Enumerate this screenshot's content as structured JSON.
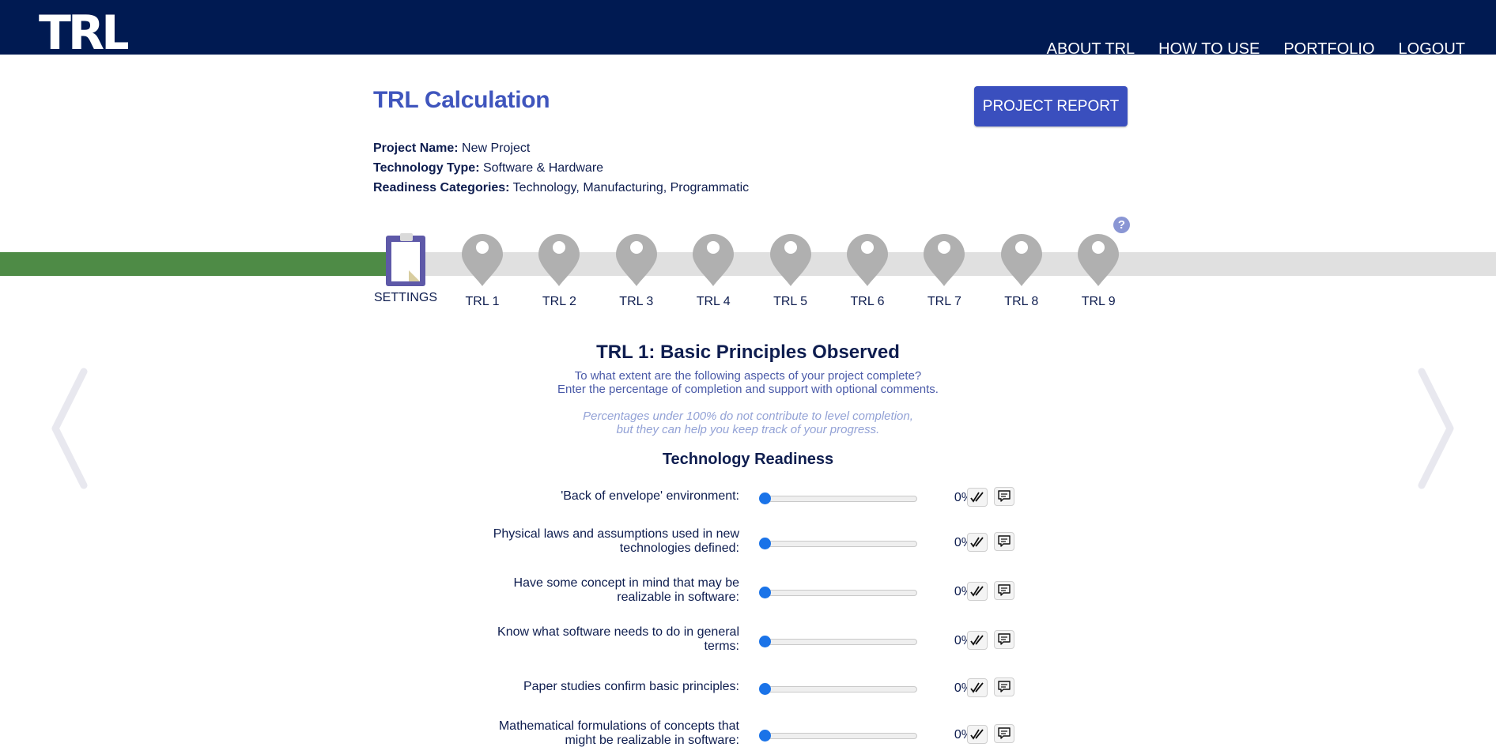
{
  "header": {
    "logo": "TRL",
    "nav": [
      "ABOUT TRL",
      "HOW TO USE",
      "PORTFOLIO",
      "LOGOUT"
    ]
  },
  "page": {
    "title": "TRL Calculation",
    "report_button": "PROJECT REPORT",
    "project_name_label": "Project Name:",
    "project_name": "New Project",
    "tech_type_label": "Technology Type:",
    "tech_type": "Software & Hardware",
    "categories_label": "Readiness Categories:",
    "categories": "Technology, Manufacturing, Programmatic"
  },
  "stepper": {
    "help": "?",
    "settings_label": "SETTINGS",
    "steps": [
      "TRL 1",
      "TRL 2",
      "TRL 3",
      "TRL 4",
      "TRL 5",
      "TRL 6",
      "TRL 7",
      "TRL 8",
      "TRL 9"
    ]
  },
  "level": {
    "title": "TRL 1: Basic Principles Observed",
    "desc_line1": "To what extent are the following aspects of your project complete?",
    "desc_line2": "Enter the percentage of completion and support with optional comments.",
    "note_line1": "Percentages under 100% do not contribute to level completion,",
    "note_line2": "but they can help you keep track of your progress.",
    "section_title": "Technology Readiness"
  },
  "questions": [
    {
      "q1": "'Back of envelope' environment:",
      "q2": "",
      "pct": "0%",
      "value": 0
    },
    {
      "q1": "Physical laws and assumptions used in new",
      "q2": "technologies defined:",
      "pct": "0%",
      "value": 0
    },
    {
      "q1": "Have some concept in mind that may be",
      "q2": "realizable in software:",
      "pct": "0%",
      "value": 0
    },
    {
      "q1": "Know what software needs to do in general",
      "q2": "terms:",
      "pct": "0%",
      "value": 0
    },
    {
      "q1": "Paper studies confirm basic principles:",
      "q2": "",
      "pct": "0%",
      "value": 0
    },
    {
      "q1": "Mathematical formulations of concepts that",
      "q2": "might be realizable in software:",
      "pct": "0%",
      "value": 0
    }
  ],
  "colors": {
    "navy": "#001a52",
    "accent": "#3a4fbe",
    "progress_green": "#4e8b46",
    "pin_grey": "#b0b0b0",
    "slider_blue": "#1a73e8"
  }
}
